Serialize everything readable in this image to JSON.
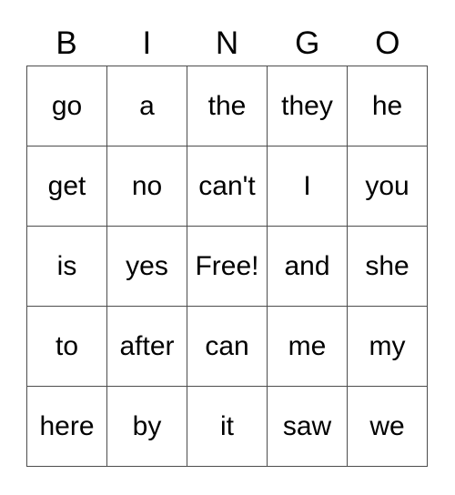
{
  "card": {
    "title": "BINGO",
    "headers": [
      "B",
      "I",
      "N",
      "G",
      "O"
    ],
    "grid": [
      [
        "go",
        "a",
        "the",
        "they",
        "he"
      ],
      [
        "get",
        "no",
        "can't",
        "I",
        "you"
      ],
      [
        "is",
        "yes",
        "Free!",
        "and",
        "she"
      ],
      [
        "to",
        "after",
        "can",
        "me",
        "my"
      ],
      [
        "here",
        "by",
        "it",
        "saw",
        "we"
      ]
    ],
    "free_space": {
      "label": "Free!",
      "row": 2,
      "column": 2
    },
    "colors": {
      "background": "#ffffff",
      "cell_background": "#ffffff",
      "border": "#4d4d4d",
      "text": "#000000"
    },
    "dimensions": {
      "columns": 5,
      "rows": 5
    }
  }
}
